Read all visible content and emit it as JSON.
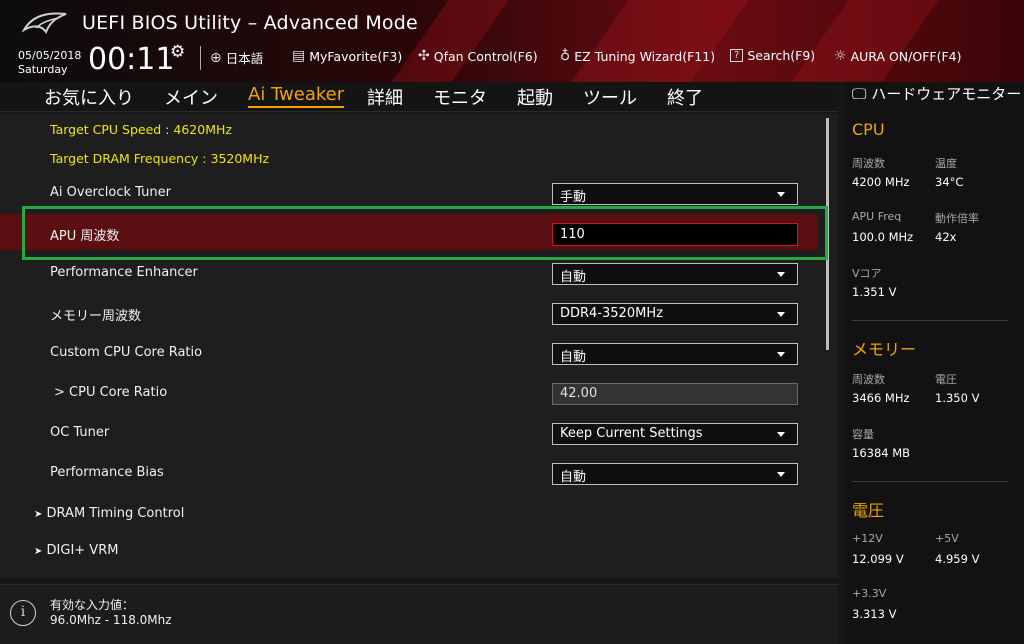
{
  "header": {
    "title": "UEFI BIOS Utility – Advanced Mode",
    "date": "05/05/2018",
    "weekday": "Saturday",
    "time": "00:11",
    "tools": {
      "language": "日本語",
      "myfavorite": "MyFavorite(F3)",
      "qfan": "Qfan Control(F6)",
      "ez_tuning": "EZ Tuning Wizard(F11)",
      "search": "Search(F9)",
      "aura": "AURA ON/OFF(F4)"
    }
  },
  "nav": {
    "items": [
      "お気に入り",
      "メイン",
      "Ai Tweaker",
      "詳細",
      "モニタ",
      "起動",
      "ツール",
      "終了"
    ],
    "active": "Ai Tweaker"
  },
  "main": {
    "target_cpu_speed": "Target CPU Speed : 4620MHz",
    "target_dram_freq": "Target DRAM Frequency : 3520MHz",
    "ai_overclock_tuner": {
      "label": "Ai Overclock Tuner",
      "value": "手動"
    },
    "apu_freq": {
      "label": "APU 周波数",
      "value": "110"
    },
    "performance_enhancer": {
      "label": "Performance Enhancer",
      "value": "自動"
    },
    "memory_freq": {
      "label": "メモリー周波数",
      "value": "DDR4-3520MHz"
    },
    "custom_cpu_core_ratio": {
      "label": "Custom CPU Core Ratio",
      "value": "自動"
    },
    "cpu_core_ratio": {
      "label": "> CPU Core Ratio",
      "value": "42.00"
    },
    "oc_tuner": {
      "label": "OC Tuner",
      "value": "Keep Current Settings"
    },
    "performance_bias": {
      "label": "Performance Bias",
      "value": "自動"
    },
    "dram_timing": "DRAM Timing Control",
    "digi_vrm": "DIGI+ VRM"
  },
  "help": {
    "line1": "有効な入力値：",
    "line2": "96.0Mhz - 118.0Mhz"
  },
  "monitor": {
    "title": "ハードウェアモニター",
    "cpu": {
      "heading": "CPU",
      "freq_label": "周波数",
      "freq": "4200 MHz",
      "temp_label": "温度",
      "temp": "34°C",
      "apu_label": "APU Freq",
      "apu": "100.0 MHz",
      "ratio_label": "動作倍率",
      "ratio": "42x",
      "vcore_label": "Vコア",
      "vcore": "1.351 V"
    },
    "memory": {
      "heading": "メモリー",
      "freq_label": "周波数",
      "freq": "3466 MHz",
      "volt_label": "電圧",
      "volt": "1.350 V",
      "cap_label": "容量",
      "cap": "16384 MB"
    },
    "voltage": {
      "heading": "電圧",
      "v12_label": "+12V",
      "v12": "12.099 V",
      "v5_label": "+5V",
      "v5": "4.959 V",
      "v33_label": "+3.3V",
      "v33": "3.313 V"
    }
  },
  "colors": {
    "accent": "#f0a300",
    "highlight": "#5b0f12",
    "annotation": "#27a844",
    "info_text": "#f2e600"
  }
}
